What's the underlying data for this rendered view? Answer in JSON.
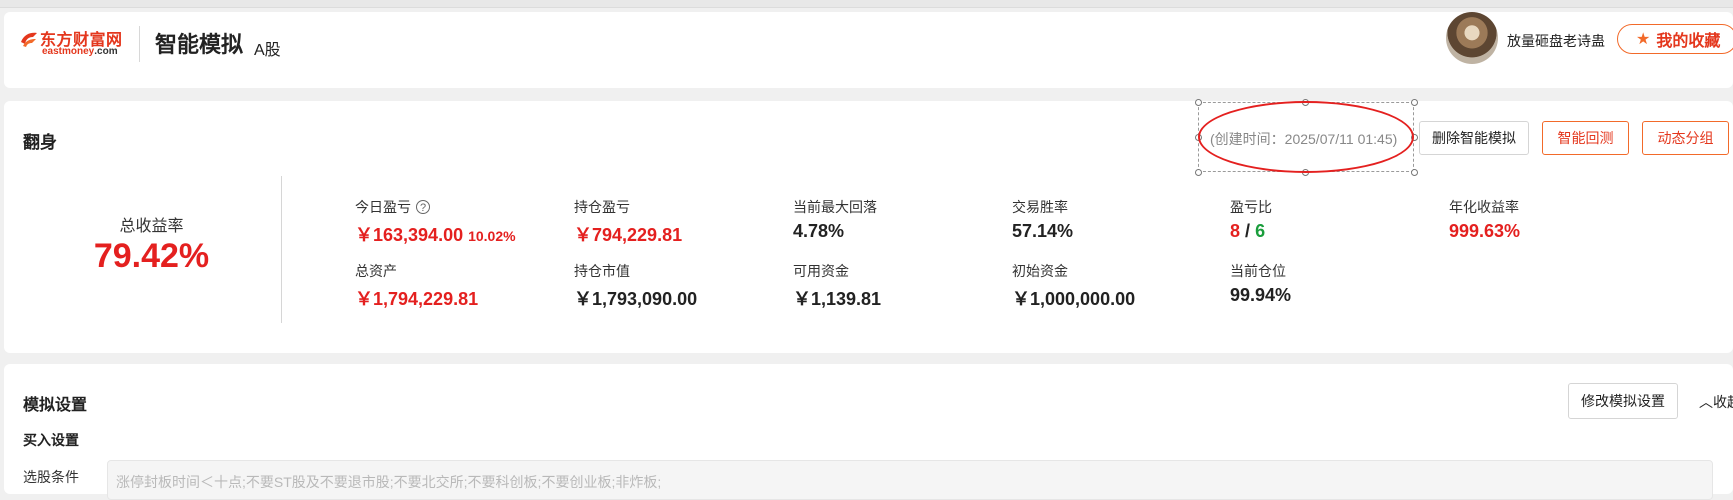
{
  "header": {
    "logo_cn": "东方财富网",
    "logo_en_brand": "eastmoney",
    "logo_en_suffix": ".com",
    "title": "智能模拟",
    "subtitle": "A股",
    "username": "放量砸盘老诗蛊",
    "favorite_label": "我的收藏"
  },
  "summary": {
    "title": "翻身",
    "created_time": "(创建时间：2025/07/11 01:45)",
    "buttons": {
      "delete": "删除智能模拟",
      "backtest": "智能回测",
      "group": "动态分组"
    },
    "total_return_label": "总收益率",
    "total_return_value": "79.42%",
    "metrics": {
      "today_pnl": {
        "label": "今日盈亏",
        "value": "￥163,394.00",
        "pct": "10.02%"
      },
      "position_pnl": {
        "label": "持仓盈亏",
        "value": "￥794,229.81"
      },
      "max_drawdown": {
        "label": "当前最大回落",
        "value": "4.78%"
      },
      "win_rate": {
        "label": "交易胜率",
        "value": "57.14%"
      },
      "profit_loss_ratio": {
        "label": "盈亏比",
        "win": "8",
        "sep": "/",
        "loss": "6"
      },
      "annual_return": {
        "label": "年化收益率",
        "value": "999.63%"
      },
      "total_assets": {
        "label": "总资产",
        "value": "￥1,794,229.81"
      },
      "market_value": {
        "label": "持仓市值",
        "value": "￥1,793,090.00"
      },
      "available_cash": {
        "label": "可用资金",
        "value": "￥1,139.81"
      },
      "initial_capital": {
        "label": "初始资金",
        "value": "￥1,000,000.00"
      },
      "position_ratio": {
        "label": "当前仓位",
        "value": "99.94%"
      }
    }
  },
  "settings": {
    "title": "模拟设置",
    "edit_button": "修改模拟设置",
    "collapse_label": "收起",
    "buy_settings": "买入设置",
    "stock_condition_label": "选股条件",
    "stock_condition_text": "涨停封板时间＜十点;不要ST股及不要退市股;不要北交所;不要科创板;不要创业板;非炸板;"
  },
  "colors": {
    "brand_red": "#e4371d",
    "accent_orange": "#f26a2a",
    "value_red": "#e4201f",
    "loss_green": "#1a9d3c",
    "annotation_red": "#e4201f"
  },
  "icons": [
    "eastmoney-logo-icon",
    "star-icon",
    "question-icon",
    "chevron-up-icon"
  ]
}
